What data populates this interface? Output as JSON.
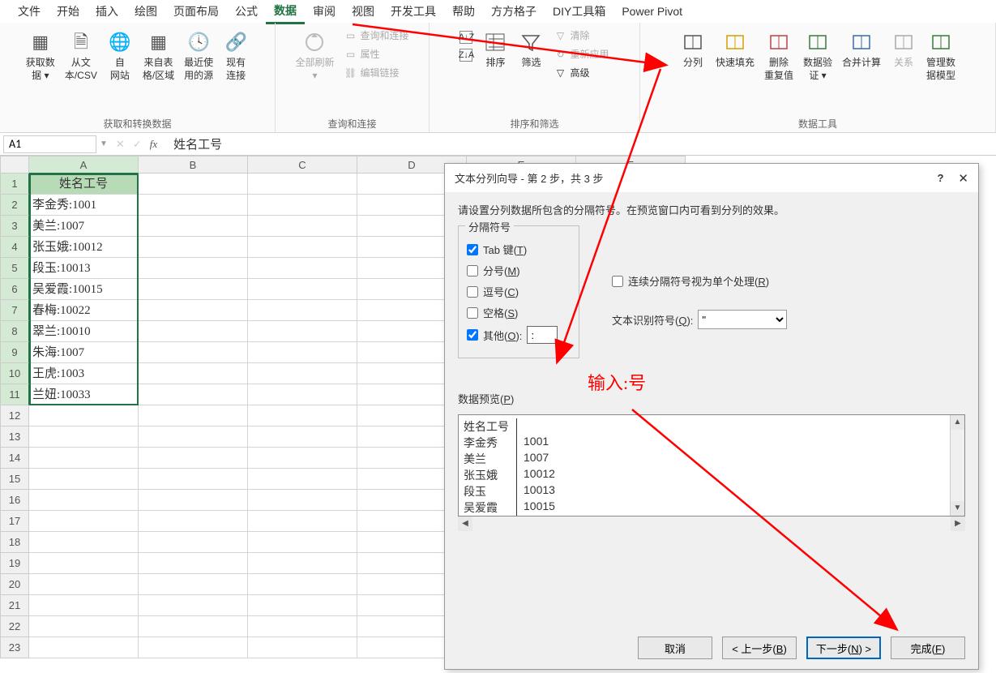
{
  "menu": [
    "文件",
    "开始",
    "插入",
    "绘图",
    "页面布局",
    "公式",
    "数据",
    "审阅",
    "视图",
    "开发工具",
    "帮助",
    "方方格子",
    "DIY工具箱",
    "Power Pivot"
  ],
  "menu_active_index": 6,
  "ribbon": {
    "group1_label": "获取和转换数据",
    "btns1": [
      "获取数\n据 ▾",
      "从文\n本/CSV",
      "自\n网站",
      "来自表\n格/区域",
      "最近使\n用的源",
      "现有\n连接"
    ],
    "group2_label": "查询和连接",
    "refresh": "全部刷新\n▾",
    "q1": "查询和连接",
    "q2": "属性",
    "q3": "编辑链接",
    "group3_label": "排序和筛选",
    "sort": "排序",
    "filter": "筛选",
    "clear": "清除",
    "reapply": "重新应用",
    "advanced": "高级",
    "group4_label": "数据工具",
    "split": "分列",
    "flash": "快速填充",
    "dedup": "删除\n重复值",
    "validate": "数据验\n证 ▾",
    "consolidate": "合并计算",
    "relations": "关系",
    "model": "管理数\n据模型"
  },
  "cell_ref": "A1",
  "formula_value": "姓名工号",
  "cols": [
    "A",
    "B",
    "C",
    "D",
    "E",
    "F"
  ],
  "rows": [
    "1",
    "2",
    "3",
    "4",
    "5",
    "6",
    "7",
    "8",
    "9",
    "10",
    "11",
    "12",
    "13",
    "14",
    "15",
    "16",
    "17",
    "18",
    "19",
    "20",
    "21",
    "22",
    "23"
  ],
  "data_cells": [
    "姓名工号",
    "李金秀:1001",
    "美兰:1007",
    "张玉娥:10012",
    "段玉:10013",
    "吴爱霞:10015",
    "春梅:10022",
    "翠兰:10010",
    "朱海:1007",
    "王虎:1003",
    "兰妞:10033"
  ],
  "dialog": {
    "title": "文本分列向导 - 第 2 步，共 3 步",
    "instruction": "请设置分列数据所包含的分隔符号。在预览窗口内可看到分列的效果。",
    "delim_legend": "分隔符号",
    "cb_tab": "Tab 键(T)",
    "cb_semicolon": "分号(M)",
    "cb_comma": "逗号(C)",
    "cb_space": "空格(S)",
    "cb_other": "其他(O):",
    "other_value": ":",
    "consecutive": "连续分隔符号视为单个处理(R)",
    "text_qualifier_label": "文本识别符号(Q):",
    "text_qualifier_value": "\"",
    "preview_label": "数据预览(P)",
    "preview_rows": [
      {
        "c1": "姓名工号",
        "c2": ""
      },
      {
        "c1": "李金秀",
        "c2": "1001"
      },
      {
        "c1": "美兰",
        "c2": "1007"
      },
      {
        "c1": "张玉娥",
        "c2": "10012"
      },
      {
        "c1": "段玉",
        "c2": "10013"
      },
      {
        "c1": "吴爱霞",
        "c2": "10015"
      }
    ],
    "btn_cancel": "取消",
    "btn_back": "< 上一步(B)",
    "btn_next": "下一步(N) >",
    "btn_finish": "完成(F)"
  },
  "annotation_text": "输入:号"
}
